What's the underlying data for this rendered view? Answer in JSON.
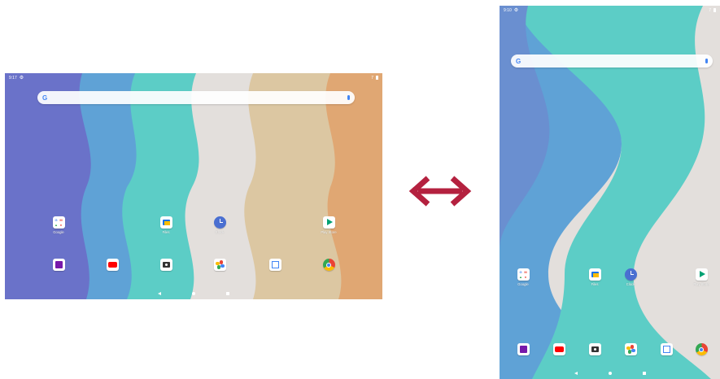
{
  "colors": {
    "arrow": "#b4213f",
    "wave_purple": "#6a72c9",
    "wave_blue": "#5fa2d6",
    "wave_teal": "#5ccdc6",
    "wave_grey": "#e3dfdc",
    "wave_sand": "#dcc7a2",
    "wave_orange": "#e0a773"
  },
  "landscape": {
    "status_time": "9:17",
    "status_right": "7",
    "apps": [
      {
        "label": "Google",
        "icon": "google-folder-icon"
      },
      {
        "label": "Files",
        "icon": "files-icon"
      },
      {
        "label": "Clock",
        "icon": "clock-icon"
      },
      {
        "label": "Play Store",
        "icon": "play-store-icon"
      }
    ],
    "dock": [
      "onenote-icon",
      "youtube-icon",
      "camera-icon",
      "photos-icon",
      "calendar-icon",
      "chrome-icon"
    ]
  },
  "portrait": {
    "status_time": "9:10",
    "status_right": "7",
    "apps": [
      {
        "label": "Google",
        "icon": "google-folder-icon"
      },
      {
        "label": "Files",
        "icon": "files-icon"
      },
      {
        "label": "Clock",
        "icon": "clock-icon"
      },
      {
        "label": "Play Store",
        "icon": "play-store-icon"
      }
    ],
    "dock": [
      "onenote-icon",
      "youtube-icon",
      "camera-icon",
      "photos-icon",
      "calendar-icon",
      "chrome-icon"
    ]
  }
}
